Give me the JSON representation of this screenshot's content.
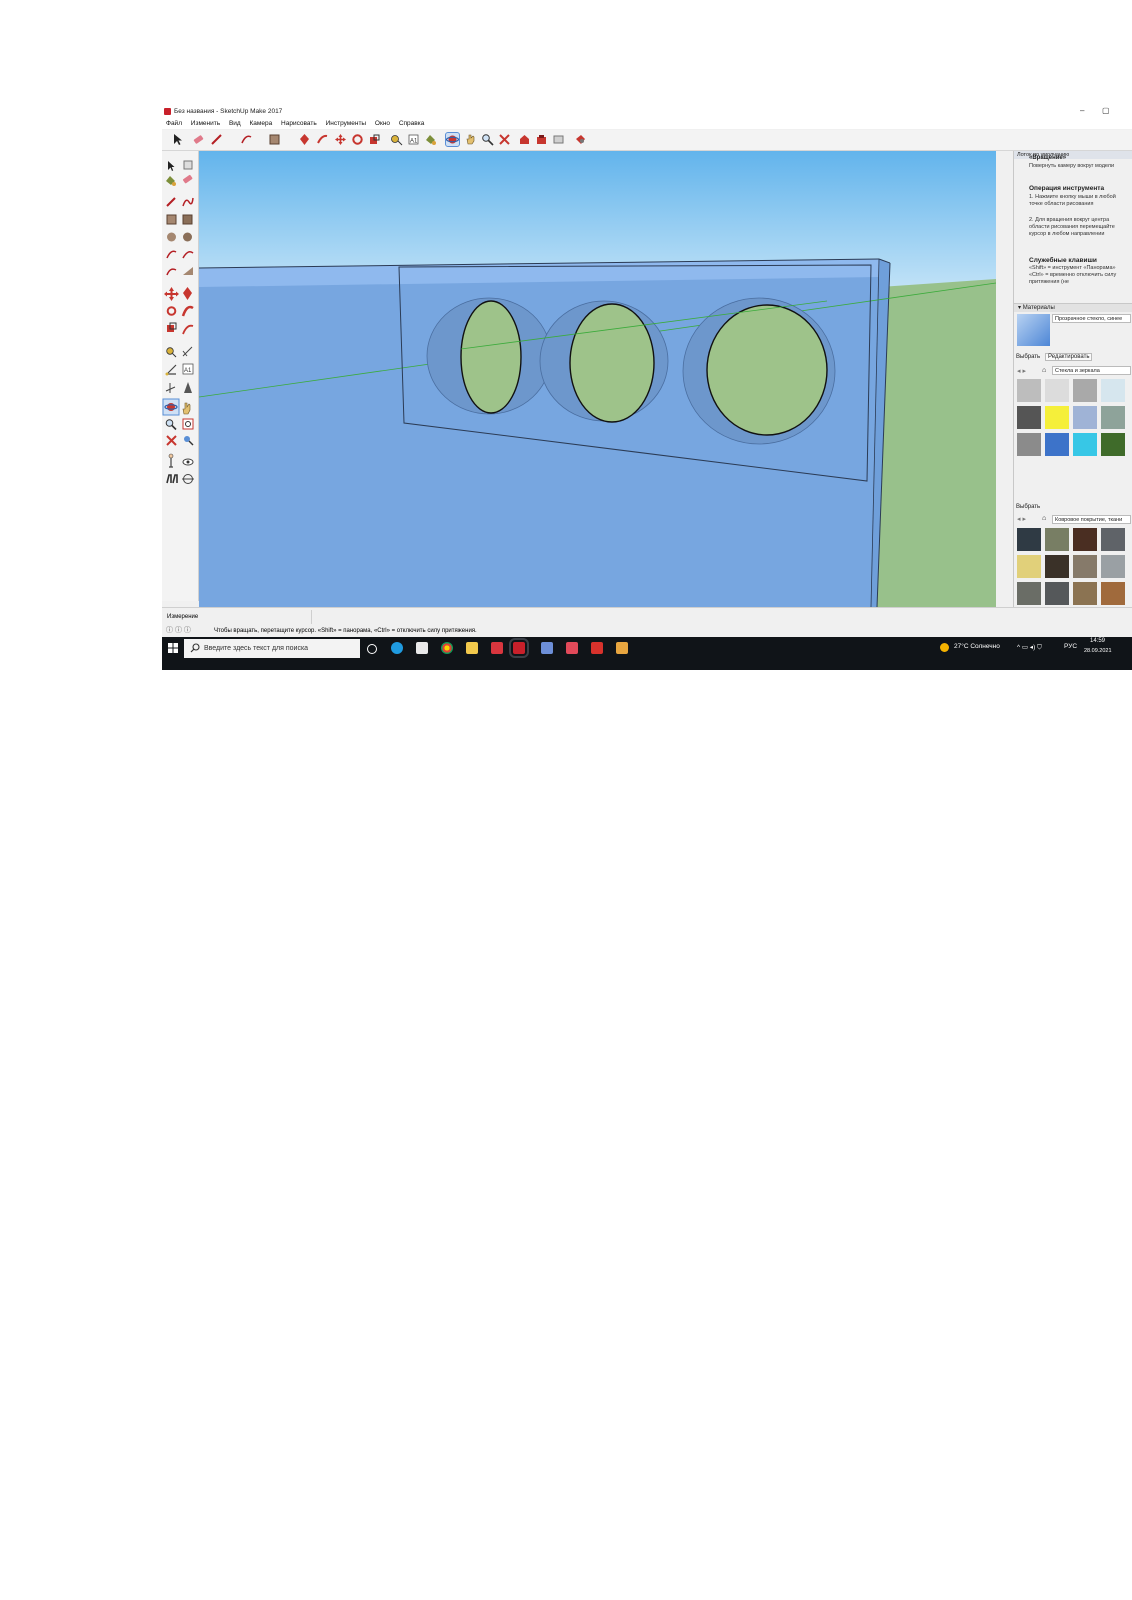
{
  "window": {
    "title": "Без названия - SketchUp Make 2017",
    "minimize_glyph": "–",
    "maximize_glyph": "▢"
  },
  "menu": [
    "Файл",
    "Изменить",
    "Вид",
    "Камера",
    "Нарисовать",
    "Инструменты",
    "Окно",
    "Справка"
  ],
  "instructor": {
    "header": "Лоток по умолчанию",
    "tool_name": "«Вращение»",
    "tool_desc": "Повернуть камеру вокруг модели",
    "operation_title": "Операция инструмента",
    "steps": [
      "1. Нажмите кнопку мыши в любой точке области рисования",
      "2. Для вращения вокруг центра области рисования перемещайте курсор в любом направлении"
    ],
    "keys_title": "Служебные клавиши",
    "keys_text": "«Shift» = инструмент «Панорама» «Ctrl» = временно отключить силу притяжения (не"
  },
  "materials": {
    "header": "Материалы",
    "current_name": "Прозрачное стекло, синее",
    "tab_select": "Выбрать",
    "tab_edit": "Редактировать",
    "library": "Стекла и зеркала",
    "colors": [
      "#bdbdbd",
      "#dcdcdc",
      "#a9a9a9",
      "#d6e6ee",
      "#555555",
      "#f5ef3a",
      "#9fb3d6",
      "#8ea39a",
      "#8b8b8b",
      "#3d73c9",
      "#37c7e6",
      "#3f6b2a"
    ],
    "select_label": "Выбрать",
    "library2": "Ковровое покрытие, ткани",
    "colors2": [
      "#2f3a44",
      "#787e64",
      "#4a2e22",
      "#5f6368",
      "#e1d07a",
      "#3a3128",
      "#867a6a",
      "#9aa0a4",
      "#6a6d66",
      "#55585a",
      "#8b7352",
      "#a06a3c"
    ]
  },
  "status": {
    "measure_label": "Измерение",
    "hint": "Чтобы вращать, перетащите курсор. «Shift» = панорама, «Ctrl» = отключить силу притяжения."
  },
  "taskbar": {
    "search_placeholder": "Введите здесь текст для поиска",
    "weather": "27°C  Солнечно",
    "lang": "РУС",
    "time": "14:59",
    "date": "28.09.2021"
  },
  "colors": {
    "sky_top": "#62b4ec",
    "sky_bottom": "#cde8f8",
    "ground": "#98c18b",
    "glass": "#77a6e0",
    "glass_top": "#8fb9ee",
    "hole_green": "#9ec38a",
    "hole_edge": "#6d97cc"
  }
}
